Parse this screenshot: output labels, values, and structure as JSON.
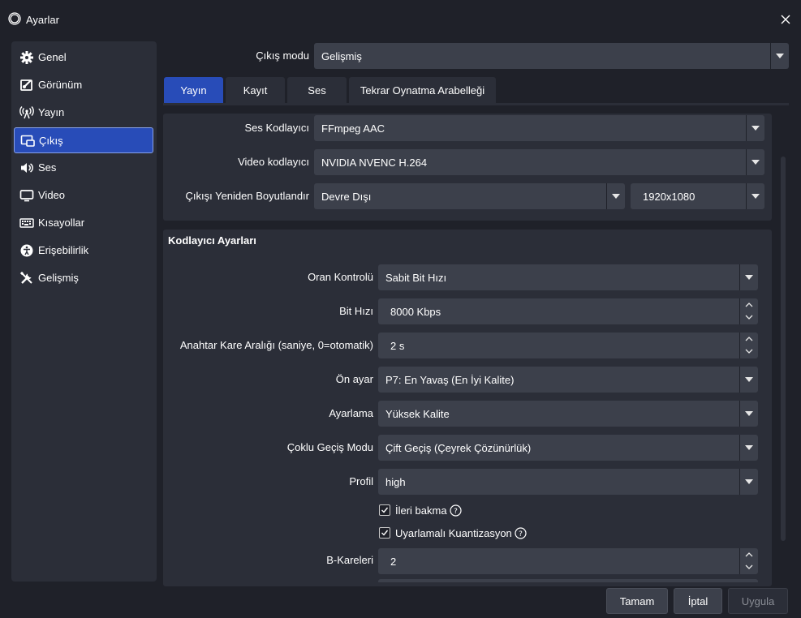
{
  "window": {
    "title": "Ayarlar"
  },
  "sidebar": {
    "items": [
      {
        "label": "Genel",
        "icon": "gear-icon"
      },
      {
        "label": "Görünüm",
        "icon": "appearance-icon"
      },
      {
        "label": "Yayın",
        "icon": "broadcast-icon"
      },
      {
        "label": "Çıkış",
        "icon": "output-icon"
      },
      {
        "label": "Ses",
        "icon": "speaker-icon"
      },
      {
        "label": "Video",
        "icon": "monitor-icon"
      },
      {
        "label": "Kısayollar",
        "icon": "keyboard-icon"
      },
      {
        "label": "Erişebilirlik",
        "icon": "accessibility-icon"
      },
      {
        "label": "Gelişmiş",
        "icon": "tools-icon"
      }
    ],
    "active_index": 3
  },
  "output_mode": {
    "label": "Çıkış modu",
    "value": "Gelişmiş"
  },
  "tabs": [
    {
      "label": "Yayın"
    },
    {
      "label": "Kayıt"
    },
    {
      "label": "Ses"
    },
    {
      "label": "Tekrar Oynatma Arabelleği"
    }
  ],
  "stream": {
    "audio_encoder": {
      "label": "Ses Kodlayıcı",
      "value": "FFmpeg AAC"
    },
    "video_encoder": {
      "label": "Video kodlayıcı",
      "value": "NVIDIA NVENC H.264"
    },
    "rescale": {
      "label": "Çıkışı Yeniden Boyutlandır",
      "value": "Devre Dışı",
      "resolution": "1920x1080"
    }
  },
  "encoder_settings": {
    "title": "Kodlayıcı Ayarları",
    "rate_control": {
      "label": "Oran Kontrolü",
      "value": "Sabit Bit Hızı"
    },
    "bitrate": {
      "label": "Bit Hızı",
      "value": "8000 Kbps"
    },
    "keyframe": {
      "label": "Anahtar Kare Aralığı (saniye, 0=otomatik)",
      "value": "2 s"
    },
    "preset": {
      "label": "Ön ayar",
      "value": "P7: En Yavaş (En İyi Kalite)"
    },
    "tuning": {
      "label": "Ayarlama",
      "value": "Yüksek Kalite"
    },
    "multipass": {
      "label": "Çoklu Geçiş Modu",
      "value": "Çift Geçiş (Çeyrek Çözünürlük)"
    },
    "profile": {
      "label": "Profil",
      "value": "high"
    },
    "lookahead": {
      "label": "İleri bakma",
      "checked": true
    },
    "adaptive_quant": {
      "label": "Uyarlamalı Kuantizasyon",
      "checked": true
    },
    "b_frames": {
      "label": "B-Kareleri",
      "value": "2"
    }
  },
  "buttons": {
    "ok": "Tamam",
    "cancel": "İptal",
    "apply": "Uygula"
  },
  "colors": {
    "accent": "#284cb8",
    "panel": "#2b2e38",
    "background": "#1f2129",
    "input": "#3c404b"
  }
}
